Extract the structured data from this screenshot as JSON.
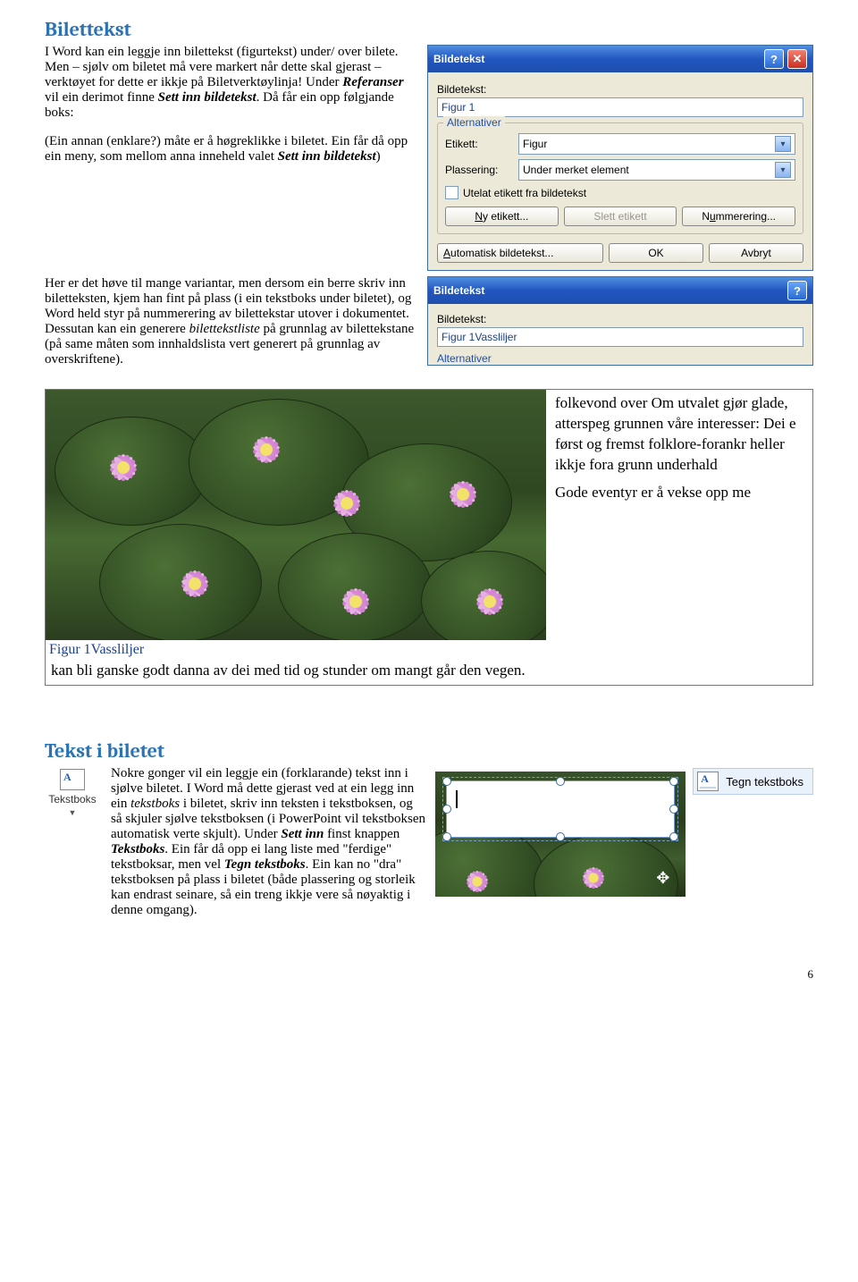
{
  "section1": {
    "heading": "Bilettekst",
    "para_a": "I Word kan ein leggje inn bilettekst (figurtekst) under/ over bilete. Men – sjølv om biletet må vere markert når dette skal gjerast – verktøyet for dette er ikkje på Biletverktøylinja! Under ",
    "para_b_ref": "Referanser",
    "para_c": " vil ein derimot finne ",
    "para_d_sett": "Sett inn bildetekst",
    "para_e": ". Då får ein opp følgjande boks:",
    "para2_a": "(Ein annan (enklare?) måte er å høgreklikke i biletet. Ein får då opp ein meny, som mellom anna inneheld valet ",
    "para2_b": "Sett inn bildetekst",
    "para2_c": ")",
    "para3_a": "Her er det høve til mange variantar, men dersom ein berre skriv inn biletteksten, kjem han fint på plass (i ein tekstboks under biletet), og Word held styr på nummerering av bilettekstar utover i dokumentet. Dessutan kan ein generere ",
    "para3_b": "bilettekstliste",
    "para3_c": " på grunnlag av bilettekstane (på same måten som innhaldslista vert generert på grunnlag av overskriftene)."
  },
  "dialog1": {
    "title": "Bildetekst",
    "label_bildetekst": "Bildetekst:",
    "input_value": "Figur 1",
    "grp": "Alternativer",
    "etikett_lbl": "Etikett:",
    "etikett_val": "Figur",
    "plassering_lbl": "Plassering:",
    "plassering_val": "Under merket element",
    "utelat": "Utelat etikett fra bildetekst",
    "btn_nyetikett": "Ny etikett...",
    "btn_slett": "Slett etikett",
    "btn_num": "Nummerering...",
    "btn_auto": "Automatisk bildetekst...",
    "btn_ok": "OK",
    "btn_avbryt": "Avbryt"
  },
  "dialog2": {
    "title": "Bildetekst",
    "label": "Bildetekst:",
    "value": "Figur 1Vassliljer",
    "alt": "Alternativer"
  },
  "docfig": {
    "right_text": "folkevond over Om utvalet gjør glade, atterspeg grunnen våre interesser: Dei e først og fremst folklore-forankr heller ikkje fora grunn underhald",
    "right_text2": "Gode eventyr er å vekse opp me",
    "caption": "Figur 1Vassliljer",
    "below": "kan bli ganske godt danna av dei med tid og stunder om mangt går den vegen."
  },
  "section2": {
    "heading": "Tekst i biletet",
    "p1_a": "Nokre gonger vil ein leggje ein (forklarande) tekst inn i sjølve biletet. I Word må dette gjerast ved at ein legg inn ein ",
    "p1_b": "tekstboks",
    "p1_c": " i biletet, skriv inn teksten i tekstboksen, og så skjuler sjølve tekstboksen (i PowerPoint vil tekstboksen automatisk verte skjult). Under ",
    "p1_d": "Sett inn",
    "p1_e": " finst knappen ",
    "p1_f": "Tekstboks",
    "p1_g": ". Ein får då opp ei lang liste med \"ferdige\" tekstboksar, men vel ",
    "p1_h": "Tegn tekstboks",
    "p1_i": ". Ein kan no \"dra\" tekstboksen på plass i biletet (både plassering og storleik kan endrast seinare, så ein treng ikkje vere så nøyaktig i denne omgang).",
    "icon_label": "Tekstboks",
    "ribbon_label": "Tegn tekstboks"
  },
  "page_number": "6"
}
